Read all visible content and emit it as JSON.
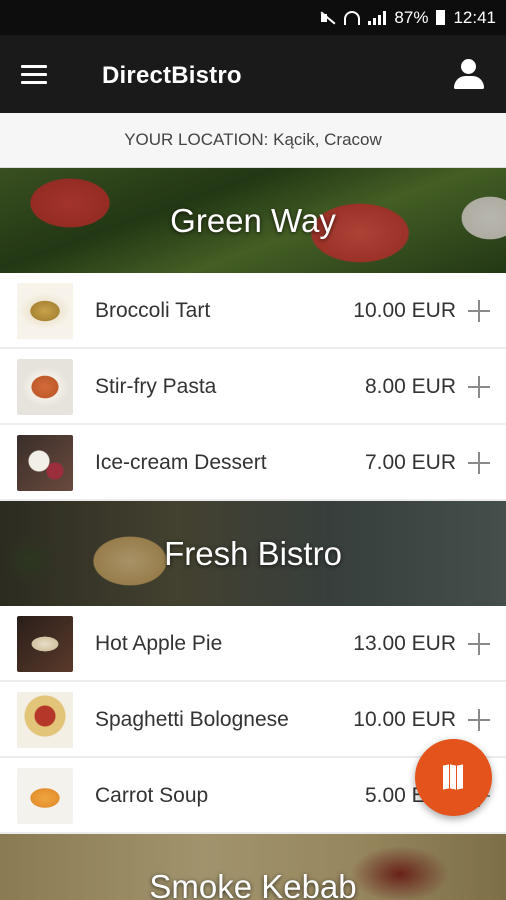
{
  "status_bar": {
    "battery": "87%",
    "time": "12:41",
    "icons": [
      "mute-icon",
      "wifi-icon",
      "signal-icon",
      "battery-icon"
    ]
  },
  "app_bar": {
    "title": "DirectBistro",
    "menu_icon": "menu-icon",
    "account_icon": "account-icon"
  },
  "location": {
    "text": "YOUR LOCATION: Kącik, Cracow"
  },
  "restaurants": [
    {
      "name": "Green Way",
      "items": [
        {
          "name": "Broccoli Tart",
          "price": "10.00 EUR"
        },
        {
          "name": "Stir-fry Pasta",
          "price": "8.00 EUR"
        },
        {
          "name": "Ice-cream Dessert",
          "price": "7.00 EUR"
        }
      ]
    },
    {
      "name": "Fresh Bistro",
      "items": [
        {
          "name": "Hot Apple Pie",
          "price": "13.00 EUR"
        },
        {
          "name": "Spaghetti Bolognese",
          "price": "10.00 EUR"
        },
        {
          "name": "Carrot Soup",
          "price": "5.00 EUR"
        }
      ]
    },
    {
      "name": "Smoke Kebab",
      "items": []
    }
  ],
  "fab": {
    "icon": "map-icon"
  },
  "colors": {
    "accent": "#e4531b",
    "app_bar": "#1a1a1a",
    "status_bar": "#0d0d0d"
  }
}
